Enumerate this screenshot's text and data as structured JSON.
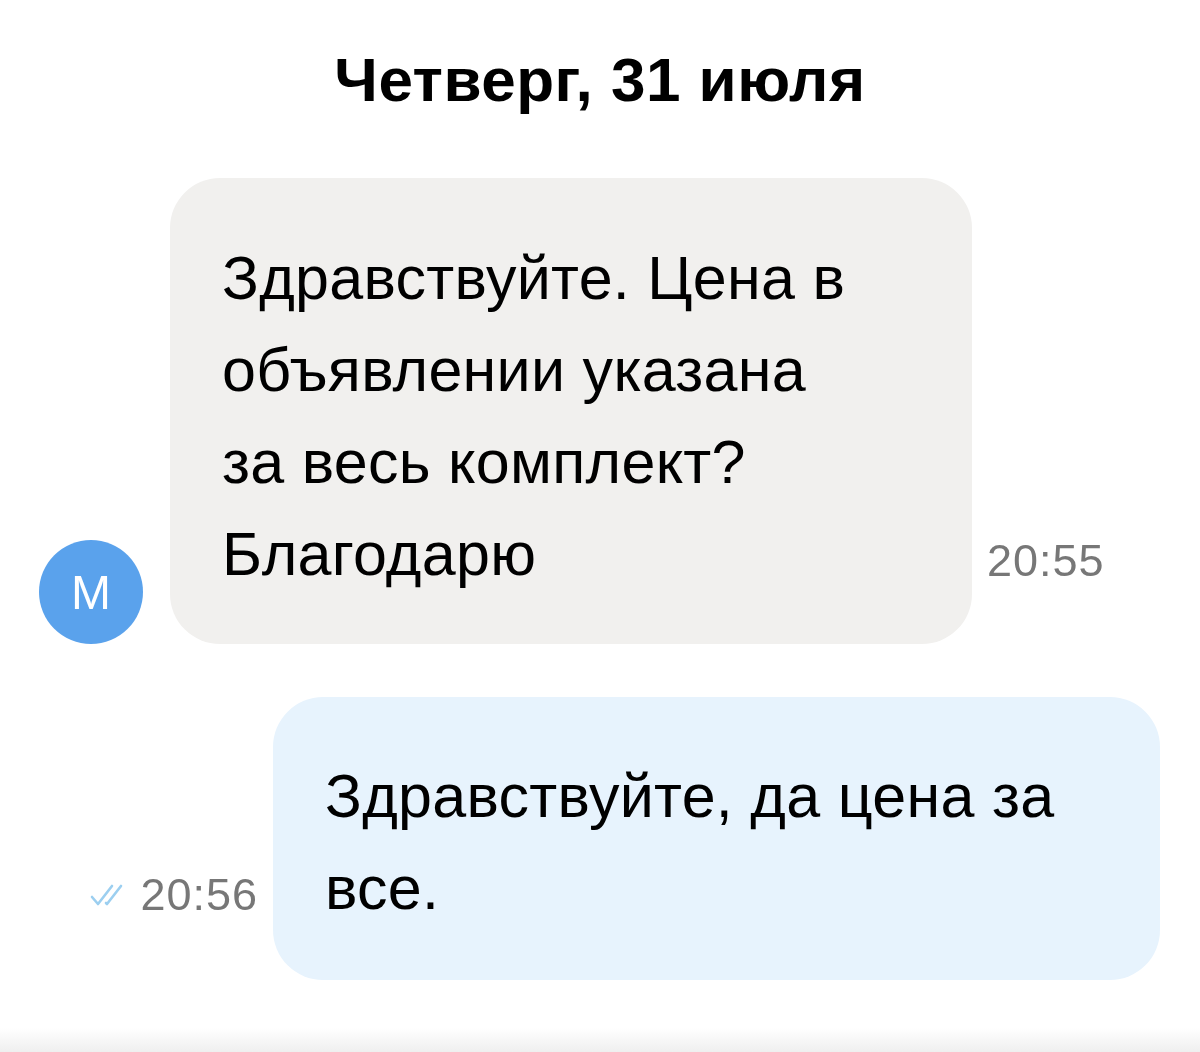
{
  "date_header": "Четверг, 31 июля",
  "messages": [
    {
      "kind": "incoming",
      "avatar_letter": "М",
      "text": "Здравствуйте. Цена в объявлении указана за весь комплект? Благодарю",
      "time": "20:55"
    },
    {
      "kind": "outgoing",
      "text": "Здравствуйте, да цена за все.",
      "time": "20:56",
      "read": true
    }
  ]
}
